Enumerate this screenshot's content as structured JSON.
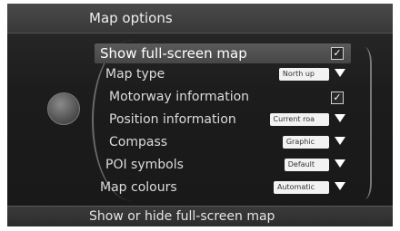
{
  "header": {
    "title": "Map options"
  },
  "items": [
    {
      "label": "Show full-screen map",
      "control": "checkbox",
      "checked": true,
      "selected": true
    },
    {
      "label": "Map type",
      "control": "dropdown",
      "value": "North up"
    },
    {
      "label": "Motorway information",
      "control": "checkbox",
      "checked": true
    },
    {
      "label": "Position information",
      "control": "dropdown",
      "value": "Current roa"
    },
    {
      "label": "Compass",
      "control": "dropdown",
      "value": "Graphic"
    },
    {
      "label": "POI symbols",
      "control": "dropdown",
      "value": "Default"
    },
    {
      "label": "Map colours",
      "control": "dropdown",
      "value": "Automatic"
    }
  ],
  "footer": {
    "hint": "Show or hide full-screen map"
  },
  "icons": {
    "knob": "compass-knob-icon",
    "checkmark": "checkmark-icon",
    "dropdown": "triangle-down-icon"
  },
  "colors": {
    "background": "#1c1c1c",
    "header": "#404040",
    "selected_row": "#555555",
    "text": "#dcdcdc"
  }
}
